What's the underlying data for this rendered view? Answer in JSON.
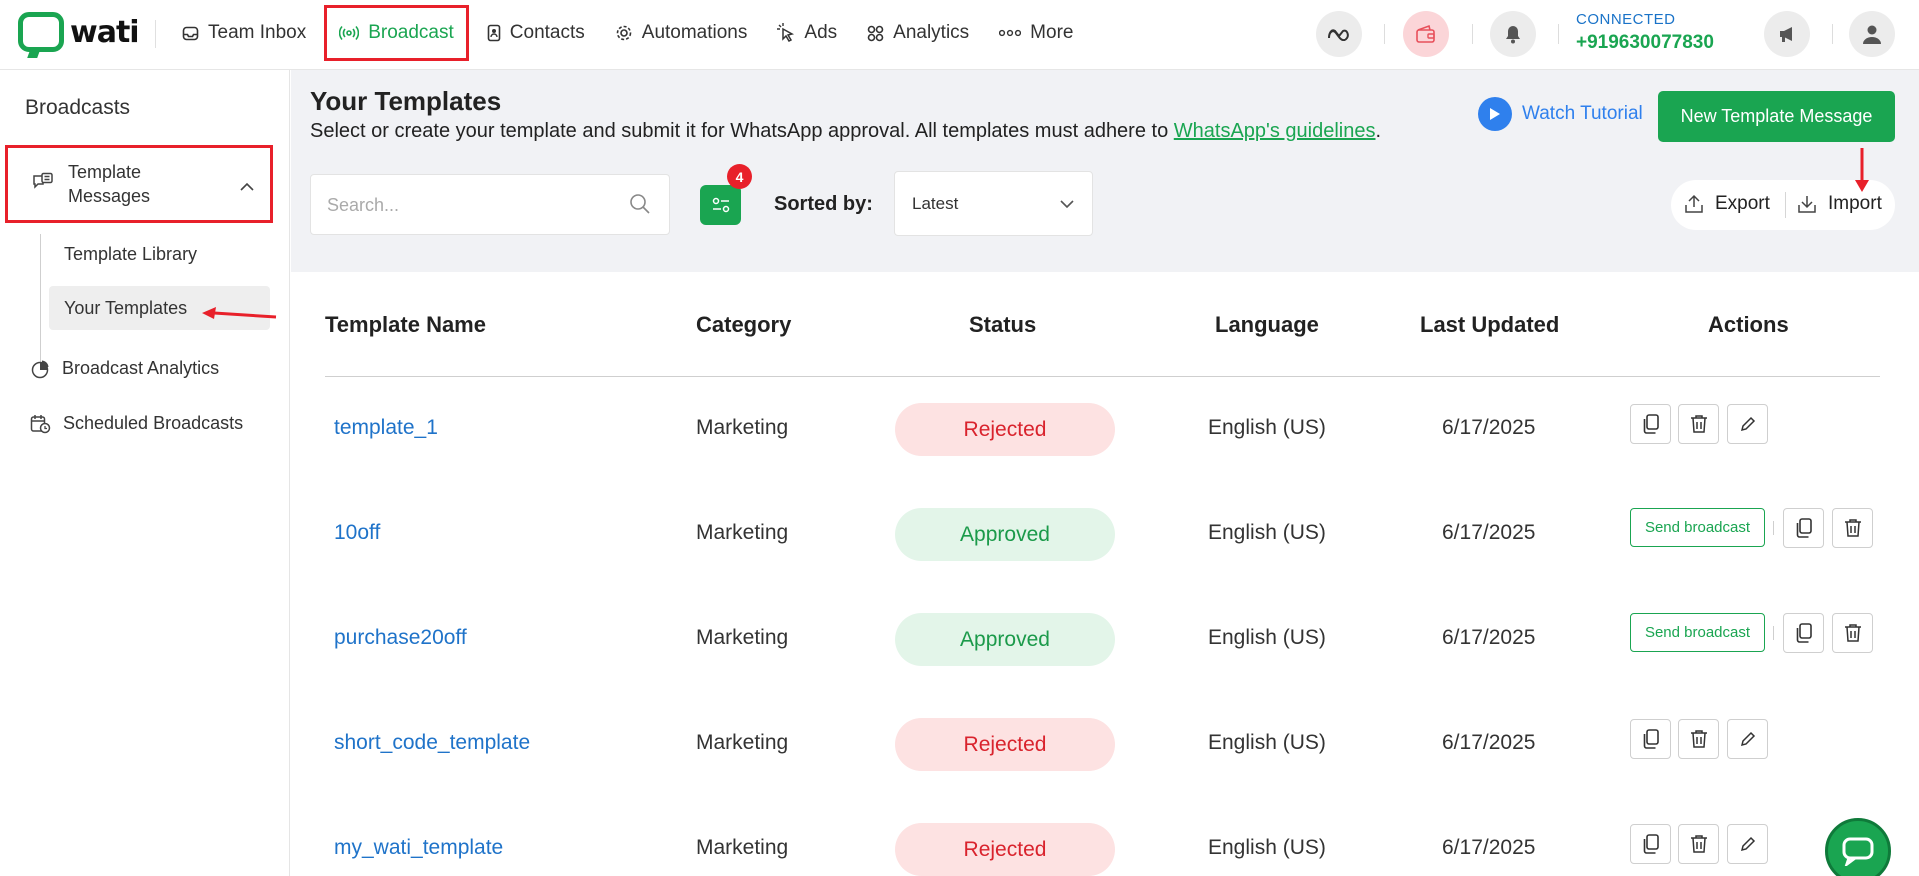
{
  "brand": {
    "name": "wati",
    "accent": "#1aa551",
    "highlight": "#e8202a"
  },
  "nav": {
    "items": [
      {
        "label": "Team Inbox",
        "icon": "inbox-icon"
      },
      {
        "label": "Broadcast",
        "icon": "broadcast-icon",
        "active": true
      },
      {
        "label": "Contacts",
        "icon": "contacts-icon"
      },
      {
        "label": "Automations",
        "icon": "gear-icon"
      },
      {
        "label": "Ads",
        "icon": "cursor-icon"
      },
      {
        "label": "Analytics",
        "icon": "grid-icon"
      },
      {
        "label": "More",
        "icon": "more-icon"
      }
    ]
  },
  "status": {
    "label": "CONNECTED",
    "number": "+919630077830"
  },
  "sidebar": {
    "title": "Broadcasts",
    "group_label": "Template Messages",
    "sub_items": [
      "Template Library",
      "Your Templates"
    ],
    "items": [
      "Broadcast Analytics",
      "Scheduled Broadcasts"
    ]
  },
  "page": {
    "title": "Your Templates",
    "subtitle": "Select or create your template and submit it for WhatsApp approval. All templates must adhere to ",
    "link": "WhatsApp's guidelines",
    "subtitle_end": ".",
    "watch_tutorial": "Watch Tutorial",
    "new_template": "New Template Message",
    "search_placeholder": "Search...",
    "filter_count": "4",
    "sorted_by": "Sorted by:",
    "sort_value": "Latest",
    "export": "Export",
    "import": "Import"
  },
  "table": {
    "headers": [
      "Template Name",
      "Category",
      "Status",
      "Language",
      "Last Updated",
      "Actions"
    ],
    "rows": [
      {
        "name": "template_1",
        "category": "Marketing",
        "status": "Rejected",
        "language": "English (US)",
        "updated": "6/17/2025"
      },
      {
        "name": "10off",
        "category": "Marketing",
        "status": "Approved",
        "language": "English (US)",
        "updated": "6/17/2025",
        "send": "Send broadcast"
      },
      {
        "name": "purchase20off",
        "category": "Marketing",
        "status": "Approved",
        "language": "English (US)",
        "updated": "6/17/2025",
        "send": "Send broadcast"
      },
      {
        "name": "short_code_template",
        "category": "Marketing",
        "status": "Rejected",
        "language": "English (US)",
        "updated": "6/17/2025"
      },
      {
        "name": "my_wati_template",
        "category": "Marketing",
        "status": "Rejected",
        "language": "English (US)",
        "updated": "6/17/2025"
      }
    ]
  }
}
